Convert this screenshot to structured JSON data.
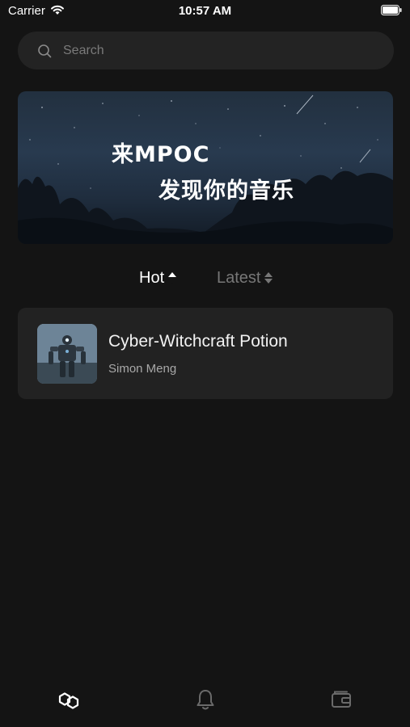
{
  "status_bar": {
    "carrier": "Carrier",
    "time": "10:57 AM"
  },
  "search": {
    "placeholder": "Search",
    "value": ""
  },
  "banner": {
    "line1": "来MPOC",
    "line2": "发现你的音乐"
  },
  "sort_tabs": {
    "hot_label": "Hot",
    "latest_label": "Latest",
    "active": "Hot"
  },
  "songs": [
    {
      "title": "Cyber-Witchcraft Potion",
      "artist": "Simon Meng"
    }
  ],
  "tab_bar": {
    "items": [
      "home-link-icon",
      "bell-icon",
      "wallet-icon"
    ]
  },
  "colors": {
    "background": "#141414",
    "card": "#222222",
    "text_primary": "#ffffff",
    "text_muted": "#777777"
  }
}
